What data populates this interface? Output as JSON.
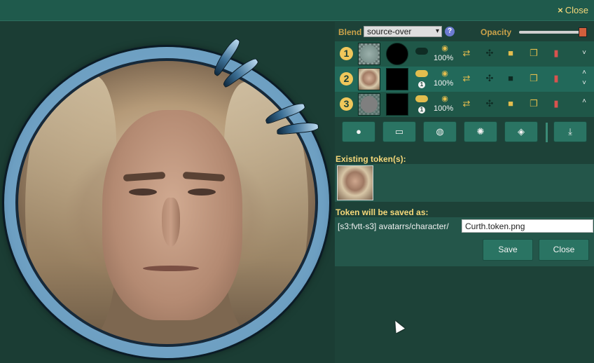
{
  "titlebar": {
    "close_label": "Close",
    "close_icon": "×"
  },
  "blend": {
    "label": "Blend",
    "mode": "source-over",
    "help": "?"
  },
  "opacity": {
    "label": "Opacity",
    "value": 1.0
  },
  "layers": [
    {
      "num": "1",
      "mask": "mask-icon",
      "visibility": "100%",
      "chevron": "˅"
    },
    {
      "num": "2",
      "mask": "mask-icon",
      "badge": "1",
      "visibility": "100%",
      "chevron_up": "˄",
      "chevron_down": "˅"
    },
    {
      "num": "3",
      "mask": "mask-icon",
      "badge": "1",
      "visibility": "100%",
      "chevron": "˄"
    }
  ],
  "tools": [
    "person-icon",
    "drive-icon",
    "globe-icon",
    "camera-icon",
    "fill-icon",
    "download-icon"
  ],
  "existing": {
    "label": "Existing token(s):"
  },
  "save": {
    "label": "Token will be saved as:",
    "path_prefix": "[s3:fvtt-s3] avatarrs/character/",
    "filename": "Curth.token.png",
    "save_button": "Save",
    "close_button": "Close"
  },
  "colors": {
    "accent": "#f5d87a",
    "panel": "#1d4238",
    "button": "#2a7463",
    "danger": "#d9534f"
  }
}
